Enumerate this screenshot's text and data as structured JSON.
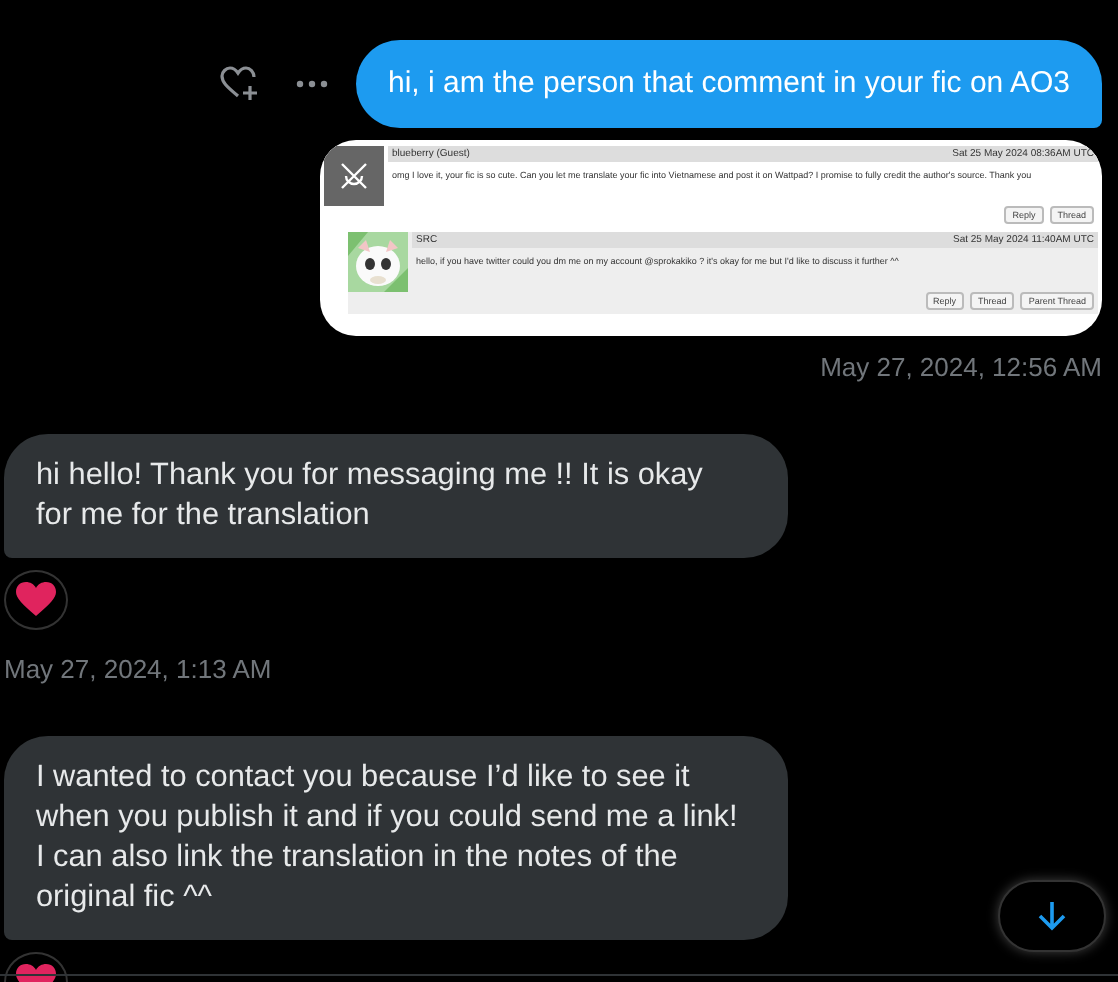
{
  "messages": [
    {
      "kind": "sent_text",
      "text": "hi, i am the person that comment in your fic on AO3"
    },
    {
      "kind": "sent_image",
      "comments": [
        {
          "author": "blueberry (Guest)",
          "date": "Sat 25 May 2024 08:36AM UTC",
          "body": "omg I love it, your fic is so cute. Can you let me translate your fic into Vietnamese and post it on Wattpad? I promise to fully credit the author's source. Thank you",
          "avatar": {
            "kind": "default"
          },
          "buttons": [
            "Reply",
            "Thread"
          ]
        },
        {
          "author": "SRC",
          "date": "Sat 25 May 2024 11:40AM UTC",
          "body": "hello, if you have twitter could you dm me on my account @sprokakiko ? it's okay for me but I'd like to discuss it further ^^",
          "buttons": [
            "Reply",
            "Thread",
            "Parent Thread"
          ]
        }
      ]
    },
    {
      "kind": "sent_timestamp",
      "text": "May 27, 2024, 12:56 AM"
    },
    {
      "kind": "received_text",
      "text": "hi hello! Thank you for messaging me !! It is okay for me for the translation"
    },
    {
      "kind": "reaction"
    },
    {
      "kind": "received_timestamp",
      "text": "May 27, 2024, 1:13 AM"
    },
    {
      "kind": "received_text",
      "text": "I wanted to contact you because I’d like to see it when you publish it and if you could send me a link! I can also link the translation in the notes of the original fic ^^"
    },
    {
      "kind": "reaction"
    }
  ]
}
